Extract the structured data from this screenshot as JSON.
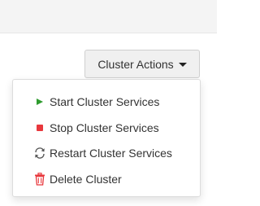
{
  "toolbar": {
    "cluster_actions_label": "Cluster Actions"
  },
  "menu": {
    "items": [
      {
        "label": "Start Cluster Services",
        "icon": "play-icon",
        "color": "#2e9b2e"
      },
      {
        "label": "Stop Cluster Services",
        "icon": "stop-icon",
        "color": "#e8383d"
      },
      {
        "label": "Restart Cluster Services",
        "icon": "refresh-icon",
        "color": "#555555"
      },
      {
        "label": "Delete Cluster",
        "icon": "trash-icon",
        "color": "#e8383d"
      }
    ]
  }
}
